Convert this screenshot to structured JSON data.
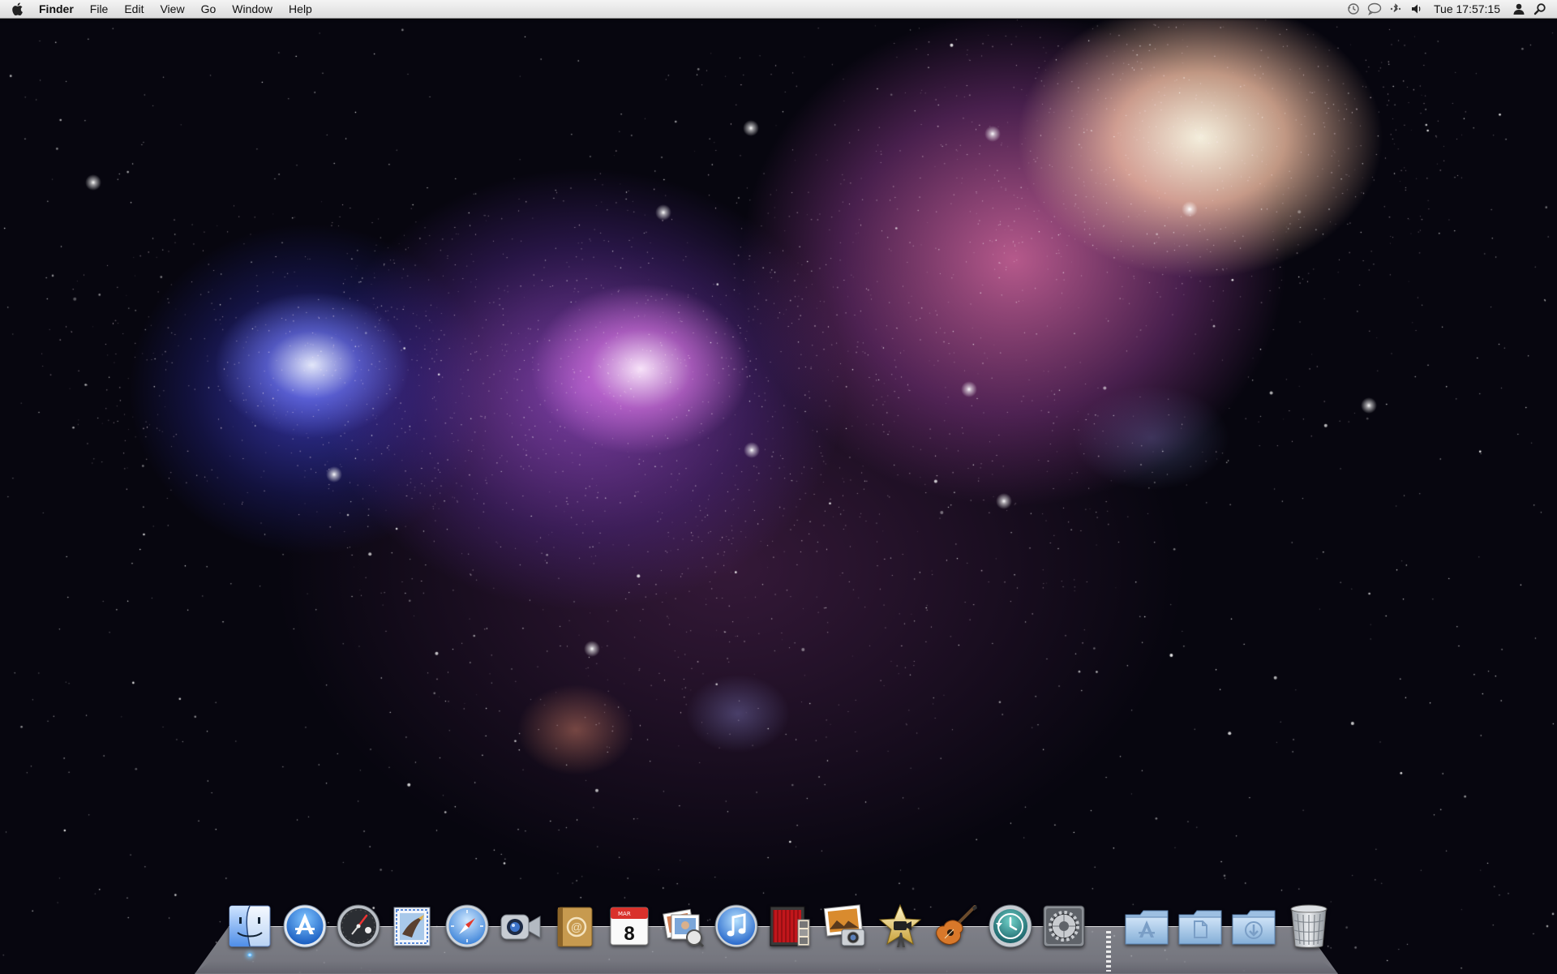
{
  "menubar": {
    "app_name": "Finder",
    "menus": [
      "File",
      "Edit",
      "View",
      "Go",
      "Window",
      "Help"
    ],
    "status_icons": [
      "time-machine-icon",
      "ichat-icon",
      "bluetooth-icon",
      "volume-icon"
    ],
    "clock": "Tue 17:57:15",
    "user_icon": "user-icon",
    "search_icon": "spotlight-icon"
  },
  "dock": {
    "apps": [
      {
        "name": "Finder",
        "icon": "finder-icon",
        "running": true
      },
      {
        "name": "App Store",
        "icon": "app-store-icon",
        "running": false
      },
      {
        "name": "Dashboard",
        "icon": "dashboard-icon",
        "running": false
      },
      {
        "name": "Mail",
        "icon": "mail-icon",
        "running": false
      },
      {
        "name": "Safari",
        "icon": "safari-icon",
        "running": false
      },
      {
        "name": "FaceTime",
        "icon": "facetime-icon",
        "running": false
      },
      {
        "name": "Address Book",
        "icon": "address-book-icon",
        "running": false
      },
      {
        "name": "iCal",
        "icon": "ical-icon",
        "running": false,
        "calendar_month": "MAR",
        "calendar_day": "8"
      },
      {
        "name": "Preview",
        "icon": "preview-icon",
        "running": false
      },
      {
        "name": "iTunes",
        "icon": "itunes-icon",
        "running": false
      },
      {
        "name": "Photo Booth",
        "icon": "photo-booth-icon",
        "running": false
      },
      {
        "name": "iPhoto",
        "icon": "iphoto-icon",
        "running": false
      },
      {
        "name": "iMovie",
        "icon": "imovie-icon",
        "running": false
      },
      {
        "name": "GarageBand",
        "icon": "garageband-icon",
        "running": false
      },
      {
        "name": "Time Machine",
        "icon": "time-machine-dock-icon",
        "running": false
      },
      {
        "name": "System Preferences",
        "icon": "system-preferences-icon",
        "running": false
      }
    ],
    "stacks": [
      {
        "name": "Applications",
        "icon": "applications-folder-icon"
      },
      {
        "name": "Documents",
        "icon": "documents-folder-icon"
      },
      {
        "name": "Downloads",
        "icon": "downloads-folder-icon"
      }
    ],
    "trash": {
      "name": "Trash",
      "icon": "trash-icon"
    }
  },
  "colors": {
    "menubar_top": "#f4f4f4",
    "menubar_bottom": "#dcdcdc",
    "space_background": "#07060f",
    "nebula_blue": "#4646dc",
    "nebula_purple": "#a050d2",
    "nebula_pink": "#e16eaa",
    "nebula_peach": "#ffc8aa"
  }
}
